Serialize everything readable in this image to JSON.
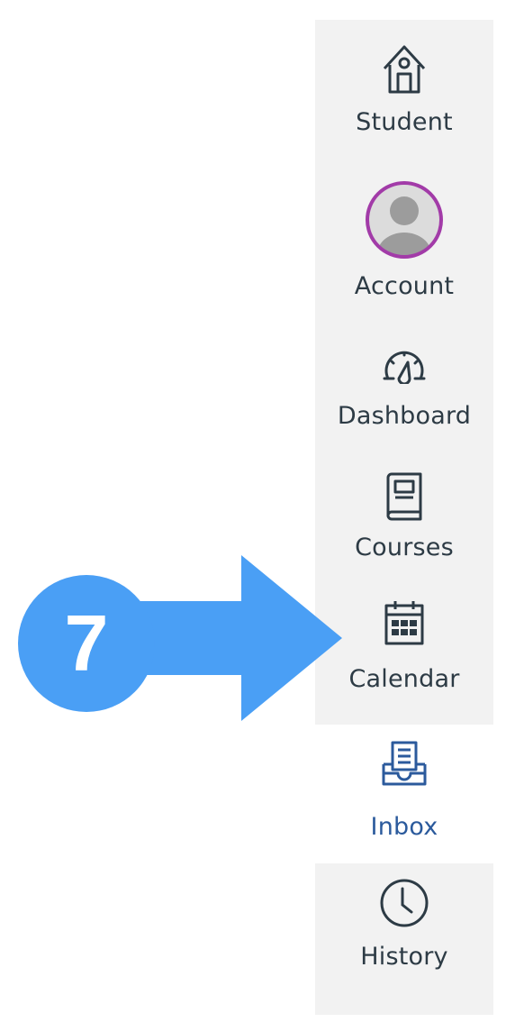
{
  "nav": {
    "items": [
      {
        "key": "student",
        "label": "Student",
        "icon": "house-icon"
      },
      {
        "key": "account",
        "label": "Account",
        "icon": "avatar"
      },
      {
        "key": "dashboard",
        "label": "Dashboard",
        "icon": "speedometer-icon"
      },
      {
        "key": "courses",
        "label": "Courses",
        "icon": "book-icon"
      },
      {
        "key": "calendar",
        "label": "Calendar",
        "icon": "calendar-icon"
      },
      {
        "key": "inbox",
        "label": "Inbox",
        "icon": "inbox-icon",
        "active": true
      },
      {
        "key": "history",
        "label": "History",
        "icon": "clock-icon"
      }
    ]
  },
  "callout": {
    "step_number": "7",
    "points_to": "calendar",
    "color": "#4a9ff5"
  },
  "colors": {
    "nav_bg": "#f2f2f2",
    "text": "#2d3b45",
    "active_text": "#2b5a9c",
    "avatar_ring": "#a23ba8",
    "avatar_fill": "#9c9c9c"
  }
}
